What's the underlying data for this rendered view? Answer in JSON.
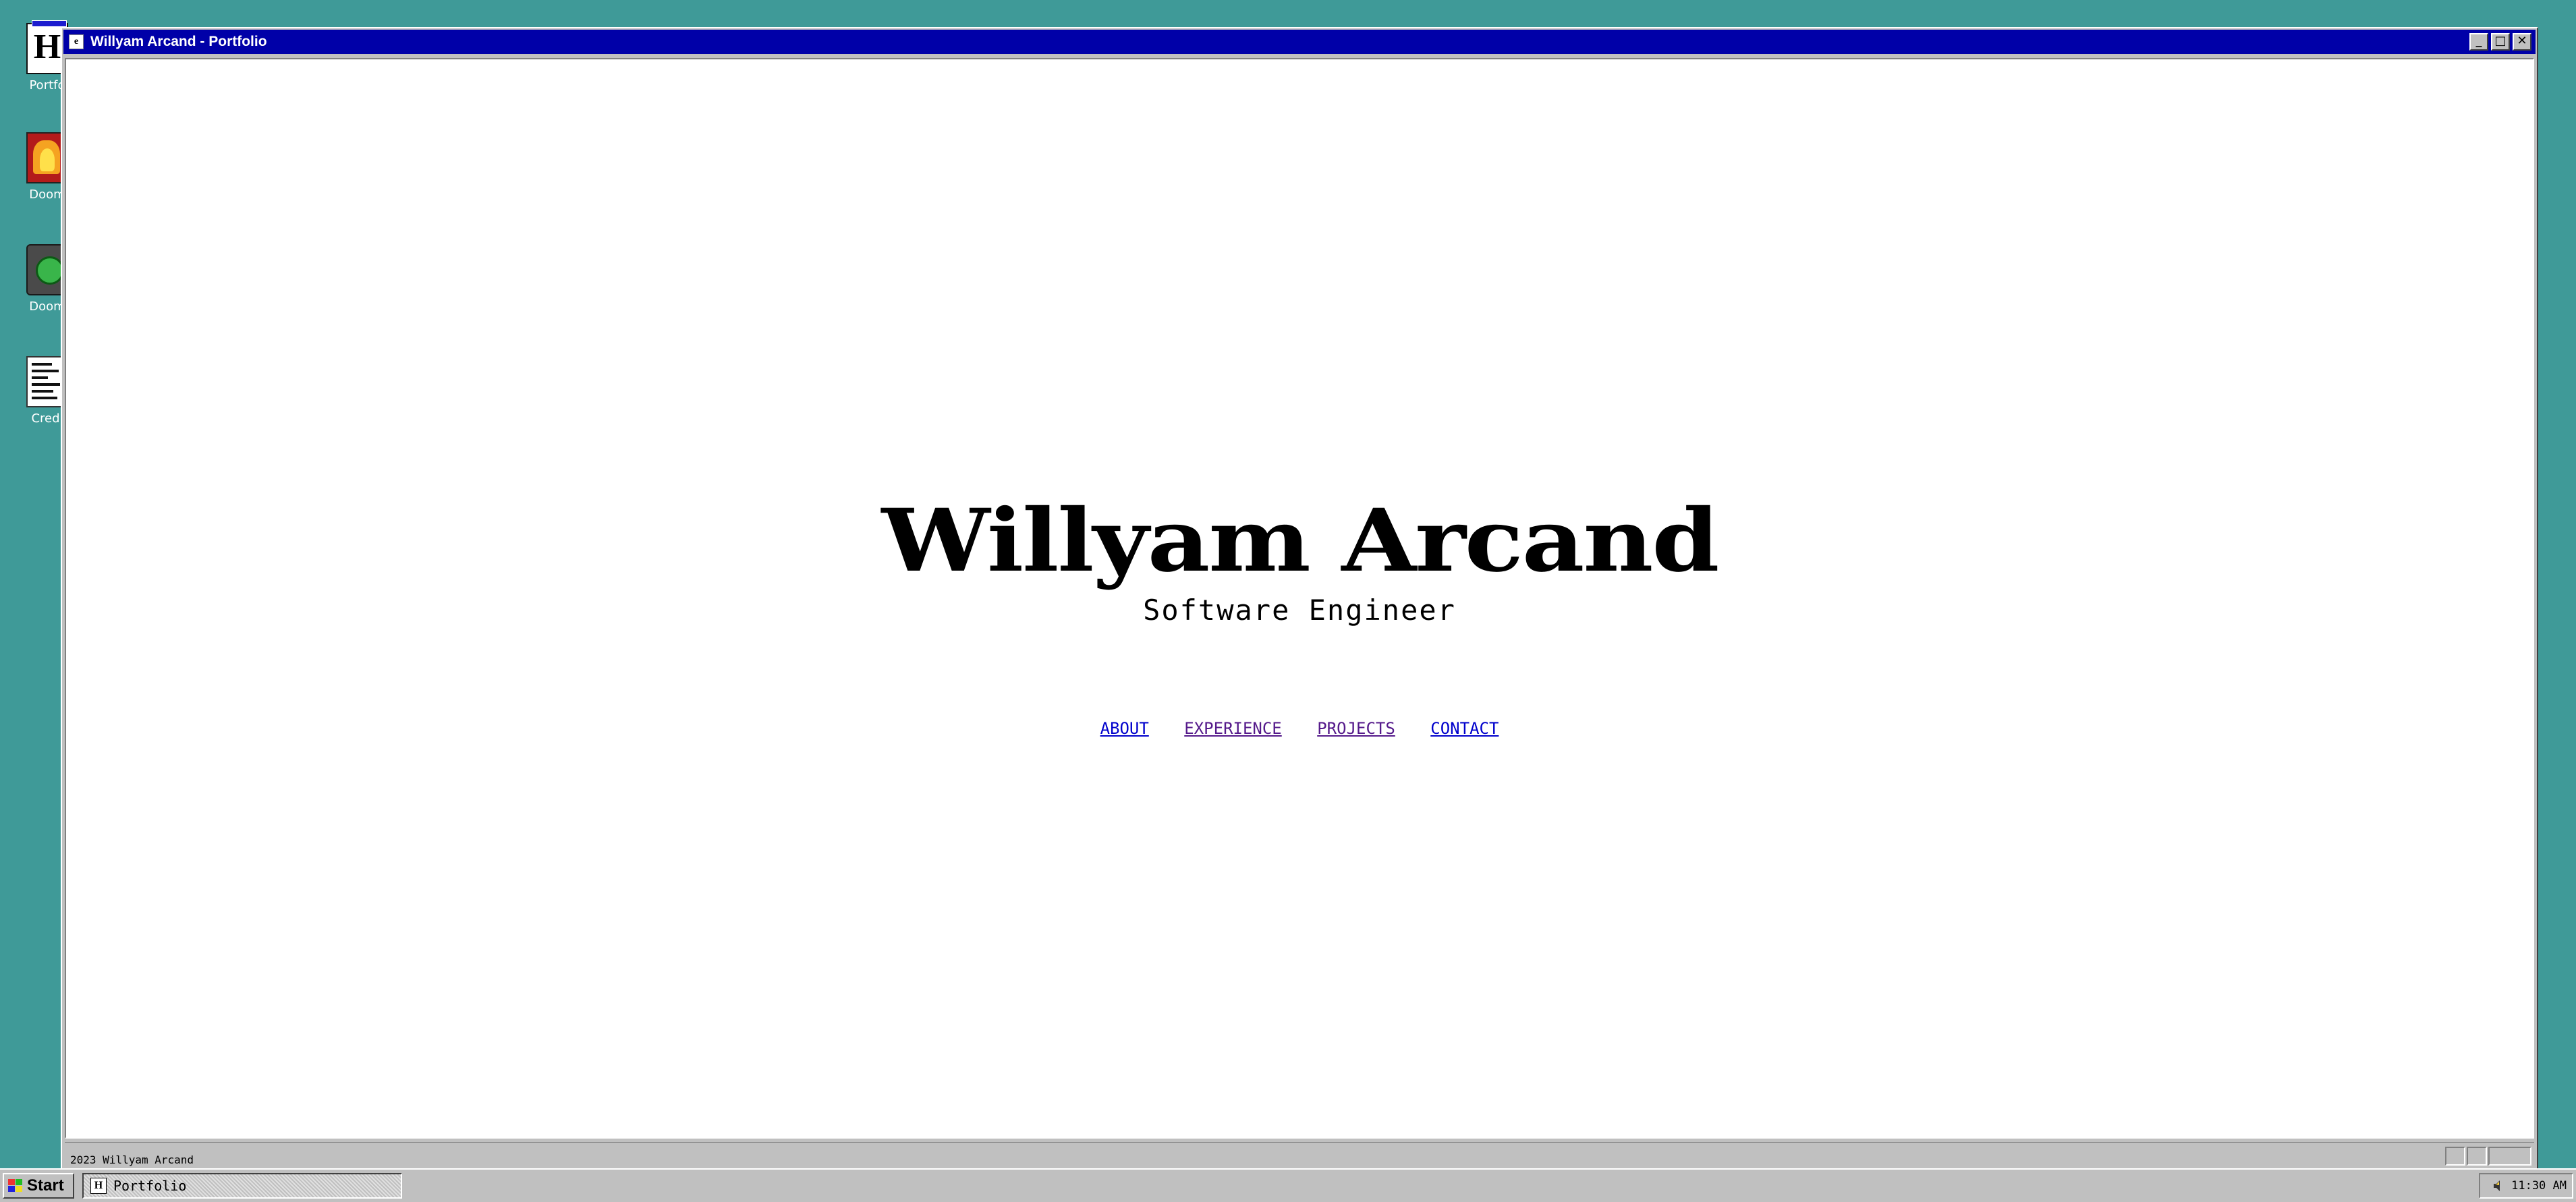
{
  "desktop": {
    "icons": [
      {
        "label": "Portfo",
        "icon": "portfolio-icon"
      },
      {
        "label": "Doom",
        "icon": "doom-icon"
      },
      {
        "label": "Doom",
        "icon": "doom2-icon"
      },
      {
        "label": "Credi",
        "icon": "credits-icon"
      }
    ],
    "background_color": "#3f9a98"
  },
  "window": {
    "title": "Willyam Arcand - Portfolio",
    "titlebar_color": "#0000a8",
    "buttons": {
      "minimize": "_",
      "maximize": "□",
      "close": "✕"
    }
  },
  "page": {
    "name": "Willyam Arcand",
    "subtitle": "Software Engineer",
    "nav": [
      "ABOUT",
      "EXPERIENCE",
      "PROJECTS",
      "CONTACT"
    ],
    "link_colors": {
      "unvisited": "#0000cc",
      "visited": "#551a8b"
    }
  },
  "statusbar": {
    "text": "2023 Willyam Arcand"
  },
  "taskbar": {
    "start_label": "Start",
    "task_label": "Portfolio",
    "clock": "11:30 AM"
  }
}
